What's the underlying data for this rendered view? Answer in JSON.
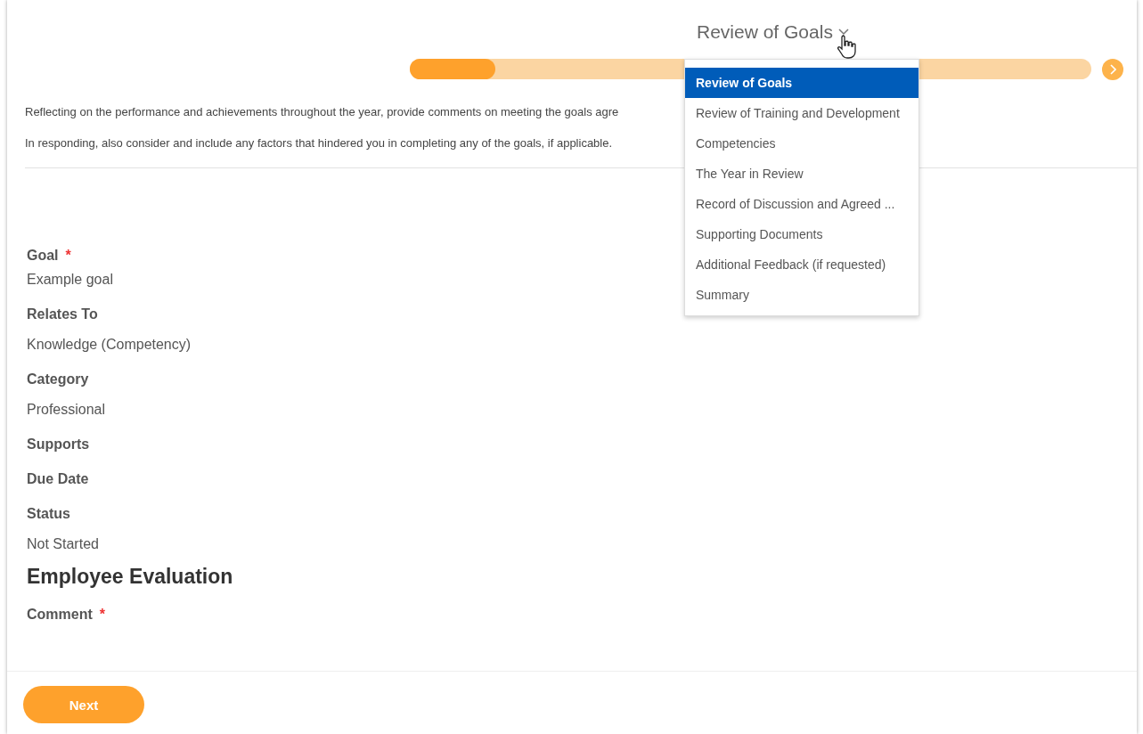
{
  "step_title": "Review of Goals",
  "progress": {
    "level": 0.125
  },
  "menu": [
    {
      "label": "Review of Goals",
      "selected": true
    },
    {
      "label": "Review of Training and Development",
      "selected": false
    },
    {
      "label": "Competencies",
      "selected": false
    },
    {
      "label": "The Year in Review",
      "selected": false
    },
    {
      "label": "Record of Discussion and Agreed ...",
      "selected": false
    },
    {
      "label": "Supporting Documents",
      "selected": false
    },
    {
      "label": "Additional Feedback (if requested)",
      "selected": false
    },
    {
      "label": "Summary",
      "selected": false
    }
  ],
  "instructions": [
    "Reflecting on the performance and achievements throughout the year, provide comments on meeting the goals agre",
    "In responding, also consider and include any factors that hindered you in completing any of the goals, if applicable."
  ],
  "fields": [
    {
      "kind": "label",
      "text": "Goal",
      "required_mark": "*"
    },
    {
      "kind": "value",
      "text": "Example goal"
    },
    {
      "kind": "label",
      "text": "Relates To"
    },
    {
      "kind": "value",
      "text": "Knowledge (Competency)"
    },
    {
      "kind": "label",
      "text": "Category"
    },
    {
      "kind": "value",
      "text": "Professional"
    },
    {
      "kind": "label",
      "text": "Supports"
    },
    {
      "kind": "label",
      "text": "Due Date"
    },
    {
      "kind": "label",
      "text": "Status"
    },
    {
      "kind": "value",
      "text": "Not Started"
    },
    {
      "kind": "heading",
      "text": "Employee Evaluation"
    },
    {
      "kind": "label",
      "text": "Comment",
      "required_mark": "*"
    }
  ],
  "next_button": "Next"
}
